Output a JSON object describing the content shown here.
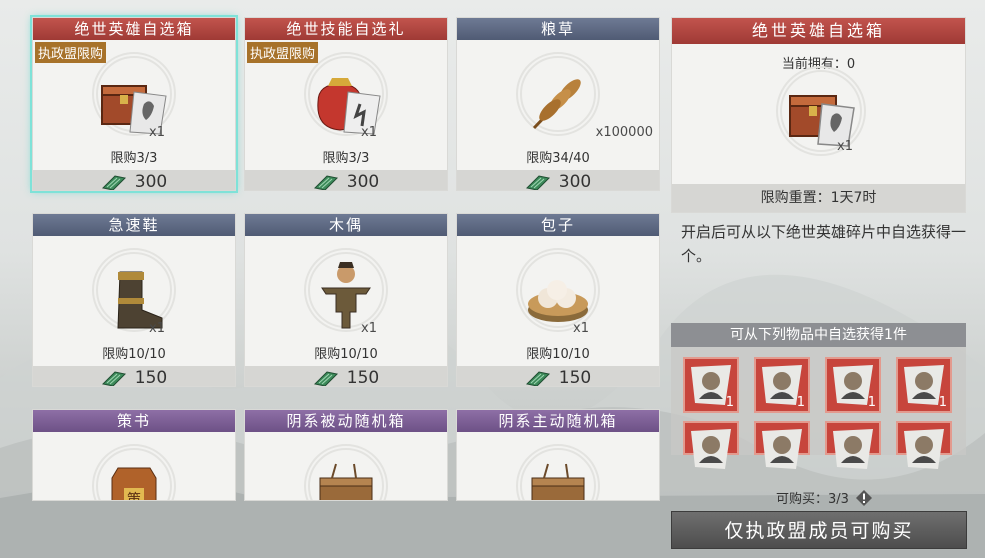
{
  "items": [
    {
      "name": "绝世英雄自选箱",
      "tag": "执政盟限购",
      "qty": "x1",
      "limit": "限购3/3",
      "price": "300",
      "header": "red",
      "art": "chest-hero"
    },
    {
      "name": "绝世技能自选礼",
      "tag": "执政盟限购",
      "qty": "x1",
      "limit": "限购3/3",
      "price": "300",
      "header": "red",
      "art": "bag-skill"
    },
    {
      "name": "粮草",
      "tag": "",
      "qty": "x100000",
      "limit": "限购34/40",
      "price": "300",
      "header": "blue",
      "art": "wheat"
    },
    {
      "name": "急速鞋",
      "tag": "",
      "qty": "x1",
      "limit": "限购10/10",
      "price": "150",
      "header": "blue",
      "art": "boot"
    },
    {
      "name": "木偶",
      "tag": "",
      "qty": "x1",
      "limit": "限购10/10",
      "price": "150",
      "header": "blue",
      "art": "puppet"
    },
    {
      "name": "包子",
      "tag": "",
      "qty": "x1",
      "limit": "限购10/10",
      "price": "150",
      "header": "blue",
      "art": "bun"
    },
    {
      "name": "策书",
      "header": "purple",
      "art": "token"
    },
    {
      "name": "阴系被动随机箱",
      "header": "purple",
      "art": "crate"
    },
    {
      "name": "阴系主动随机箱",
      "header": "purple",
      "art": "crate"
    }
  ],
  "detail": {
    "title": "绝世英雄自选箱",
    "owned": "当前拥有：0",
    "qty": "x1",
    "reset": "限购重置：1天7时",
    "description": "开启后可从以下绝世英雄碎片中自选获得一个。"
  },
  "pick": {
    "title": "可从下列物品中自选获得1件",
    "heroes": [
      {
        "count": "1"
      },
      {
        "count": "1"
      },
      {
        "count": "1"
      },
      {
        "count": "1"
      },
      {
        "count": ""
      },
      {
        "count": ""
      },
      {
        "count": ""
      },
      {
        "count": ""
      }
    ]
  },
  "purchase": {
    "count": "可购买：3/3",
    "button": "仅执政盟成员可购买"
  }
}
